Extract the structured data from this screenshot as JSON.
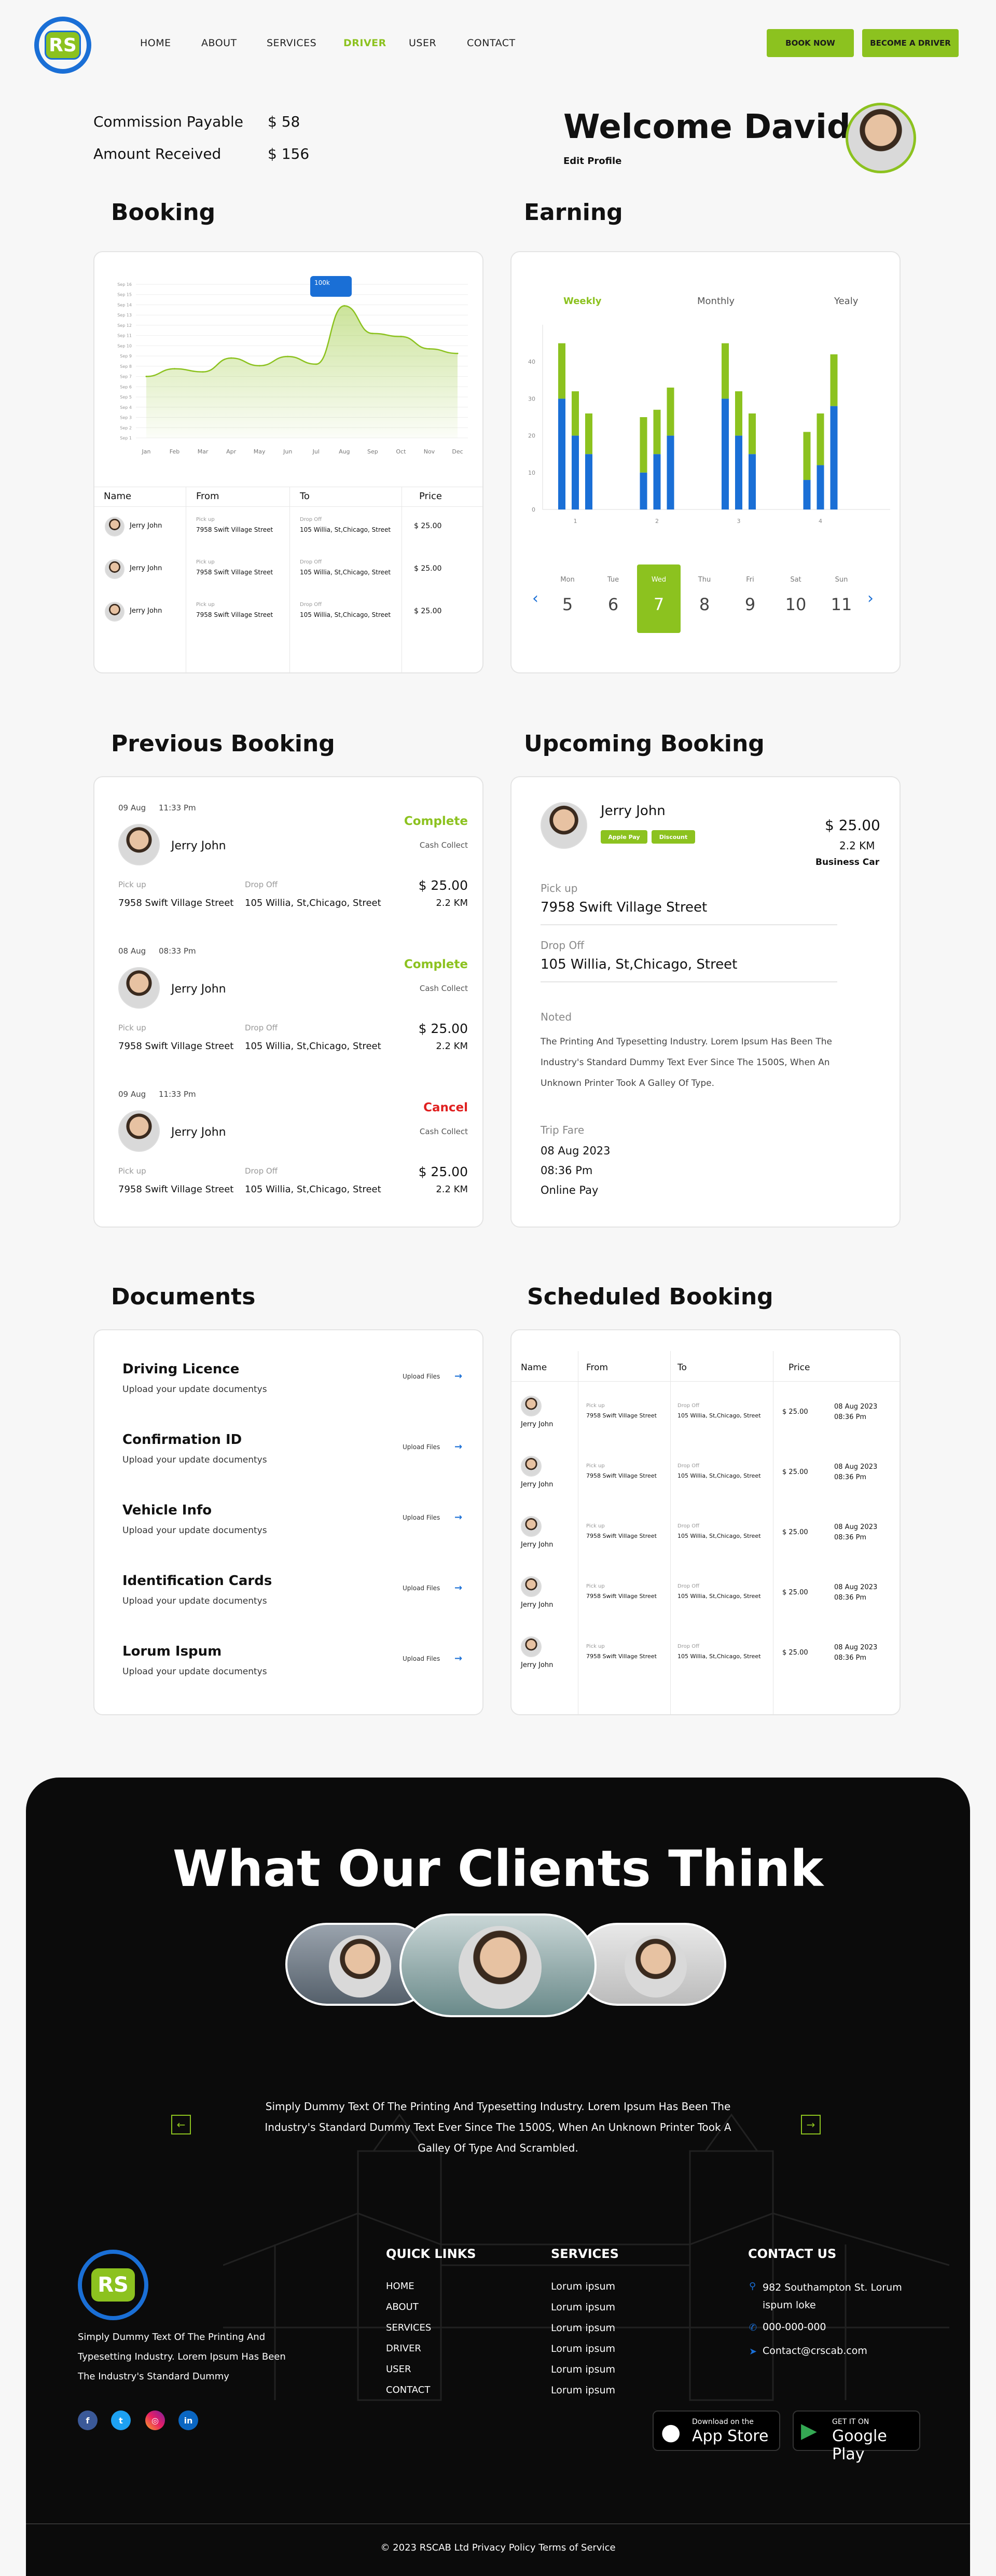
{
  "nav": {
    "logo_text": "RS",
    "links": [
      "HOME",
      "ABOUT",
      "SERVICES",
      "DRIVER",
      "USER",
      "CONTACT"
    ],
    "active": "DRIVER",
    "book_now": "BOOK NOW",
    "become_driver": "BECOME A DRIVER"
  },
  "stats": {
    "commission_label": "Commission Payable",
    "commission_value": "$ 58",
    "received_label": "Amount Received",
    "received_value": "$ 156"
  },
  "welcome": {
    "title": "Welcome David",
    "edit": "Edit Profile"
  },
  "booking": {
    "title": "Booking",
    "tooltip": "100k",
    "headers": [
      "Name",
      "From",
      "To",
      "Price"
    ],
    "rows": [
      {
        "name": "Jerry John",
        "from_label": "Pick up",
        "from": "7958 Swift Village Street",
        "to_label": "Drop Off",
        "to": "105 Willia, St,Chicago, Street",
        "price": "$ 25.00"
      },
      {
        "name": "Jerry John",
        "from_label": "Pick up",
        "from": "7958 Swift Village Street",
        "to_label": "Drop Off",
        "to": "105 Willia, St,Chicago, Street",
        "price": "$ 25.00"
      },
      {
        "name": "Jerry John",
        "from_label": "Pick up",
        "from": "7958 Swift Village Street",
        "to_label": "Drop Off",
        "to": "105 Willia, St,Chicago, Street",
        "price": "$ 25.00"
      }
    ]
  },
  "chart_data": [
    {
      "type": "area",
      "categories": [
        "Jan",
        "Feb",
        "Mar",
        "Apr",
        "May",
        "Jun",
        "Jul",
        "Aug",
        "Sep",
        "Oct",
        "Nov",
        "Dec"
      ],
      "values": [
        40,
        45,
        43,
        52,
        47,
        53,
        48,
        86,
        68,
        66,
        58,
        55
      ],
      "y_tick_labels": [
        "Sep 16",
        "Sep 15",
        "Sep 14",
        "Sep 13",
        "Sep 12",
        "Sep 11",
        "Sep 10",
        "Sep 9",
        "Sep 8",
        "Sep 7",
        "Sep 6",
        "Sep 5",
        "Sep 4",
        "Sep 3",
        "Sep 2",
        "Sep 1"
      ],
      "ylim": [
        0,
        100
      ],
      "grid": true,
      "color": "#8cc21f"
    },
    {
      "type": "bar",
      "title": "",
      "tabs": [
        "Weekly",
        "Monthly",
        "Yealy"
      ],
      "active_tab": "Weekly",
      "y_ticks": [
        "0",
        "10",
        "20",
        "30",
        "40"
      ],
      "x_ticks": [
        "1",
        "2",
        "3",
        "4"
      ],
      "ylim": [
        0,
        50
      ],
      "series_colors": [
        "#1a6fd6",
        "#8cc21f"
      ],
      "bars": [
        {
          "blue": 30,
          "green": 15
        },
        {
          "blue": 20,
          "green": 12
        },
        {
          "blue": 15,
          "green": 11
        },
        {
          "blue": 10,
          "green": 15
        },
        {
          "blue": 15,
          "green": 12
        },
        {
          "blue": 20,
          "green": 13
        },
        {
          "blue": 30,
          "green": 15
        },
        {
          "blue": 20,
          "green": 12
        },
        {
          "blue": 15,
          "green": 11
        },
        {
          "blue": 8,
          "green": 13
        },
        {
          "blue": 12,
          "green": 14
        },
        {
          "blue": 28,
          "green": 14
        }
      ]
    }
  ],
  "earning": {
    "title": "Earning",
    "days": [
      {
        "name": "Mon",
        "num": "5"
      },
      {
        "name": "Tue",
        "num": "6"
      },
      {
        "name": "Wed",
        "num": "7"
      },
      {
        "name": "Thu",
        "num": "8"
      },
      {
        "name": "Fri",
        "num": "9"
      },
      {
        "name": "Sat",
        "num": "10"
      },
      {
        "name": "Sun",
        "num": "11"
      }
    ],
    "selected_day": "7"
  },
  "previous": {
    "title": "Previous Booking",
    "items": [
      {
        "date": "09 Aug",
        "time": "11:33 Pm",
        "status": "Complete",
        "status_color": "#8cc21f",
        "name": "Jerry John",
        "payment": "Cash Collect",
        "pick_label": "Pick up",
        "pick": "7958 Swift Village Street",
        "drop_label": "Drop Off",
        "drop": "105 Willia, St,Chicago, Street",
        "price": "$ 25.00",
        "distance": "2.2 KM"
      },
      {
        "date": "08 Aug",
        "time": "08:33 Pm",
        "status": "Complete",
        "status_color": "#8cc21f",
        "name": "Jerry John",
        "payment": "Cash Collect",
        "pick_label": "Pick up",
        "pick": "7958 Swift Village Street",
        "drop_label": "Drop Off",
        "drop": "105 Willia, St,Chicago, Street",
        "price": "$ 25.00",
        "distance": "2.2 KM"
      },
      {
        "date": "09 Aug",
        "time": "11:33 Pm",
        "status": "Cancel",
        "status_color": "#e02020",
        "name": "Jerry John",
        "payment": "Cash Collect",
        "pick_label": "Pick up",
        "pick": "7958 Swift Village Street",
        "drop_label": "Drop Off",
        "drop": "105 Willia, St,Chicago, Street",
        "price": "$ 25.00",
        "distance": "2.2 KM"
      }
    ]
  },
  "upcoming": {
    "title": "Upcoming Booking",
    "name": "Jerry John",
    "badge1": "Apple Pay",
    "badge2": "Discount",
    "price": "$ 25.00",
    "distance": "2.2 KM",
    "car": "Business Car",
    "pick_label": "Pick up",
    "pick": "7958 Swift Village Street",
    "drop_label": "Drop Off",
    "drop": "105 Willia, St,Chicago, Street",
    "noted_label": "Noted",
    "noted": "The Printing And Typesetting Industry. Lorem Ipsum Has Been The Industry's Standard Dummy Text Ever Since The 1500S, When An Unknown Printer Took A Galley Of Type.",
    "fare_label": "Trip Fare",
    "fare_date": "08 Aug 2023",
    "fare_time": "08:36 Pm",
    "fare_pay": "Online Pay"
  },
  "documents": {
    "title": "Documents",
    "upload": "Upload Files",
    "items": [
      {
        "title": "Driving Licence",
        "sub": "Upload your update documentys"
      },
      {
        "title": "Confirmation ID",
        "sub": "Upload your update documentys"
      },
      {
        "title": "Vehicle Info",
        "sub": "Upload your update documentys"
      },
      {
        "title": "Identification Cards",
        "sub": "Upload your update documentys"
      },
      {
        "title": "Lorum Ispum",
        "sub": "Upload your update documentys"
      }
    ]
  },
  "scheduled": {
    "title": "Scheduled Booking",
    "headers": [
      "Name",
      "From",
      "To",
      "Price"
    ],
    "rows": [
      {
        "name": "Jerry John",
        "from_label": "Pick up",
        "from": "7958 Swift Village Street",
        "to_label": "Drop Off",
        "to": "105 Willia, St,Chicago, Street",
        "price": "$ 25.00",
        "date": "08 Aug 2023",
        "time": "08:36 Pm"
      },
      {
        "name": "Jerry John",
        "from_label": "Pick up",
        "from": "7958 Swift Village Street",
        "to_label": "Drop Off",
        "to": "105 Willia, St,Chicago, Street",
        "price": "$ 25.00",
        "date": "08 Aug 2023",
        "time": "08:36 Pm"
      },
      {
        "name": "Jerry John",
        "from_label": "Pick up",
        "from": "7958 Swift Village Street",
        "to_label": "Drop Off",
        "to": "105 Willia, St,Chicago, Street",
        "price": "$ 25.00",
        "date": "08 Aug 2023",
        "time": "08:36 Pm"
      },
      {
        "name": "Jerry John",
        "from_label": "Pick up",
        "from": "7958 Swift Village Street",
        "to_label": "Drop Off",
        "to": "105 Willia, St,Chicago, Street",
        "price": "$ 25.00",
        "date": "08 Aug 2023",
        "time": "08:36 Pm"
      },
      {
        "name": "Jerry John",
        "from_label": "Pick up",
        "from": "7958 Swift Village Street",
        "to_label": "Drop Off",
        "to": "105 Willia, St,Chicago, Street",
        "price": "$ 25.00",
        "date": "08 Aug 2023",
        "time": "08:36 Pm"
      }
    ]
  },
  "clients": {
    "title": "What Our Clients Think",
    "text": "Simply Dummy Text Of The Printing And Typesetting Industry. Lorem Ipsum Has Been The Industry's Standard Dummy Text Ever Since The 1500S, When An Unknown Printer Took A Galley Of Type And Scrambled."
  },
  "footer": {
    "about": "Simply Dummy Text Of The Printing And Typesetting Industry. Lorem Ipsum Has Been The Industry's Standard Dummy",
    "quick_title": "QUICK LINKS",
    "quick": [
      "HOME",
      "ABOUT",
      "SERVICES",
      "DRIVER",
      "USER",
      "CONTACT"
    ],
    "services_title": "SERVICES",
    "services": [
      "Lorum ipsum",
      "Lorum ipsum",
      "Lorum ipsum",
      "Lorum ipsum",
      "Lorum ipsum",
      "Lorum ipsum"
    ],
    "contact_title": "CONTACT US",
    "address": "982 Southampton St. Lorum ispum loke",
    "phone": "000-000-000",
    "email": "Contact@crscab.com",
    "appstore_small": "Download on the",
    "appstore_big": "App Store",
    "play_small": "GET IT ON",
    "play_big": "Google Play",
    "copyright": "© 2023 RSCAB Ltd Privacy Policy  Terms of Service"
  }
}
